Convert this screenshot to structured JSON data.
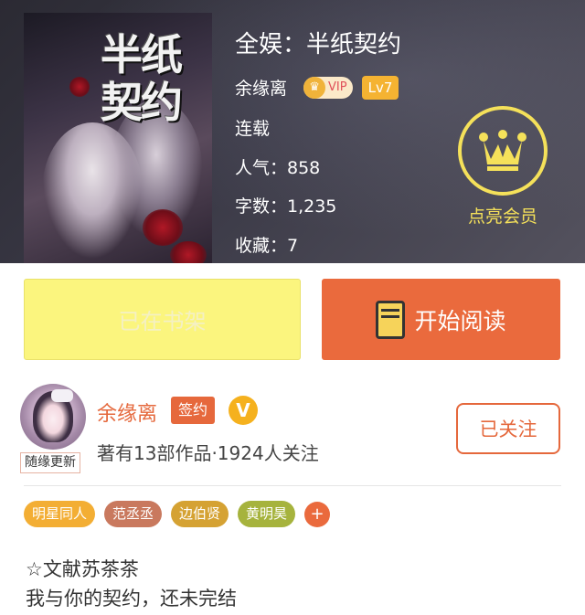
{
  "cover": {
    "title_line1": "半纸",
    "title_line2": "契约"
  },
  "book": {
    "title": "全娱：半纸契约",
    "author": "余缘离",
    "vip_label": "VIP",
    "level": "Lv7",
    "status": "连载",
    "popularity": "人气：858",
    "word_count": "字数：1,235",
    "favorites": "收藏：7"
  },
  "vip_member": {
    "label": "点亮会员",
    "icon": "crown-icon",
    "color": "#f5e15a"
  },
  "actions": {
    "shelf_label": "已在书架",
    "read_label": "开始阅读",
    "read_icon": "book-icon"
  },
  "author_card": {
    "name": "余缘离",
    "sign_badge": "签约",
    "verified_badge": "V",
    "avatar_tag": "随缘更新",
    "works_summary": "著有13部作品·1924人关注",
    "follow_label": "已关注"
  },
  "tags": [
    {
      "label": "明星同人",
      "color": "#f3ae34"
    },
    {
      "label": "范丞丞",
      "color": "#c9795e"
    },
    {
      "label": "边伯贤",
      "color": "#d5a233"
    },
    {
      "label": "黄明昊",
      "color": "#a6b33d"
    }
  ],
  "tags_more": "+",
  "description": {
    "line1": "☆文献苏茶茶",
    "line2": "我与你的契约，还未完结"
  },
  "colors": {
    "accent": "#e5683c",
    "shelf_button": "#fbf57e",
    "read_button": "#ea6a3d"
  }
}
